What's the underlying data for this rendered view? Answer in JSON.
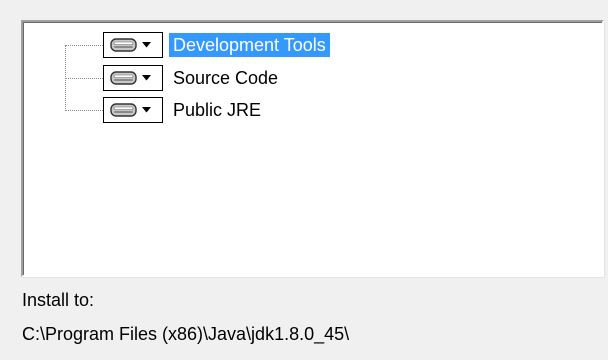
{
  "tree": {
    "items": [
      {
        "label": "Development Tools",
        "icon": "drive-icon",
        "selected": true
      },
      {
        "label": "Source Code",
        "icon": "drive-icon",
        "selected": false
      },
      {
        "label": "Public JRE",
        "icon": "drive-icon",
        "selected": false
      }
    ]
  },
  "install": {
    "label": "Install to:",
    "path": "C:\\Program Files (x86)\\Java\\jdk1.8.0_45\\"
  },
  "colors": {
    "selection": "#3399ff",
    "background": "#f0f0f0"
  }
}
